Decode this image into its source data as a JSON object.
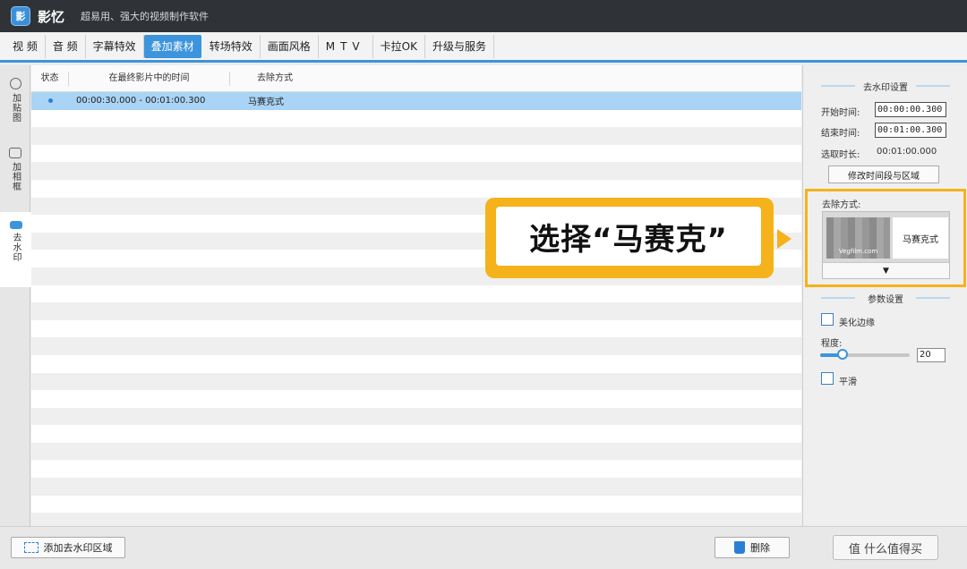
{
  "app": {
    "logo": "影",
    "name": "影忆",
    "slogan": "超易用、强大的视频制作软件"
  },
  "menu": [
    {
      "label": "视 频"
    },
    {
      "label": "音 频"
    },
    {
      "label": "字幕特效"
    },
    {
      "label": "叠加素材",
      "active": true
    },
    {
      "label": "转场特效"
    },
    {
      "label": "画面风格"
    },
    {
      "label": "MTV"
    },
    {
      "label": "卡拉OK"
    },
    {
      "label": "升级与服务"
    }
  ],
  "sidebar": {
    "items": [
      {
        "label": "加贴图"
      },
      {
        "label": "加相框"
      },
      {
        "label": "去水印",
        "active": true
      }
    ]
  },
  "table": {
    "headers": [
      "状态",
      "在最终影片中的时间",
      "去除方式"
    ],
    "selected_row": {
      "time": "00:00:30.000 - 00:01:00.300",
      "method": "马赛克式"
    }
  },
  "bottom": {
    "add_label": "添加去水印区域",
    "delete_label": "删除"
  },
  "panel": {
    "watermark_title": "去水印设置",
    "start_label": "开始时间:",
    "start_value": "00:00:00.300",
    "end_label": "结束时间:",
    "end_value": "00:01:00.300",
    "duration_label": "选取时长:",
    "duration_value": "00:01:00.000",
    "modify_button": "修改时间段与区域",
    "method_label": "去除方式:",
    "method_thumb_text": "Vegfilm.com",
    "method_name": "马赛克式",
    "dropdown_arrow": "▼",
    "params_title": "参数设置",
    "beautify_label": "美化边缘",
    "degree_label": "程度:",
    "degree_value": "20",
    "degree_fraction": 0.25,
    "smooth_label": "平滑"
  },
  "callout": {
    "text": "选择“马赛克”"
  },
  "watermark": {
    "text": "值 什么值得买"
  },
  "colors": {
    "accent": "#3c94dc",
    "callout": "#f5b21b",
    "selected_row": "#a9d4f5"
  }
}
